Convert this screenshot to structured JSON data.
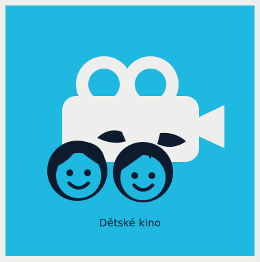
{
  "tile": {
    "label": "Dětské kino",
    "icon": "children-cinema-icon",
    "background_color": "#1fb8e0",
    "camera_color": "#eeeeec",
    "face_outline_color": "#0d1b2e"
  }
}
